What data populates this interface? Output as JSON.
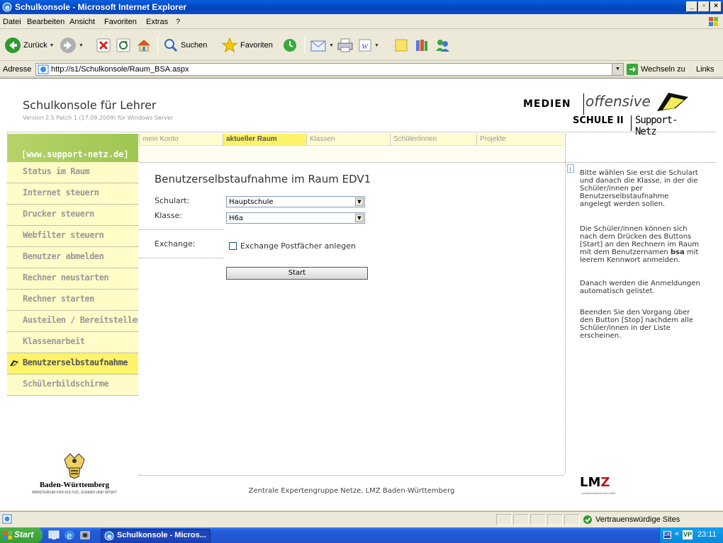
{
  "window": {
    "title": "Schulkonsole - Microsoft Internet Explorer",
    "minimize": "_",
    "maximize": "▫",
    "close": "×"
  },
  "menu": [
    "Datei",
    "Bearbeiten",
    "Ansicht",
    "Favoriten",
    "Extras",
    "?"
  ],
  "toolbar": {
    "back": "Zurück",
    "search": "Suchen",
    "favorites": "Favoriten"
  },
  "address": {
    "label": "Adresse",
    "url": "http://s1/Schulkonsole/Raum_BSA.aspx",
    "go": "Wechseln zu",
    "links": "Links"
  },
  "header": {
    "title": "Schulkonsole für Lehrer",
    "version": "Version 2.5 Patch 1 (17.09.2009) für Windows Server",
    "brand_medien": "MEDIEN",
    "brand_offensive": "offensive",
    "brand_schule": "SCHULE II",
    "brand_support": "Support-Netz"
  },
  "site_badge": "[www.support-netz.de]",
  "tabs": [
    {
      "label": "mein Konto",
      "active": false
    },
    {
      "label": "aktueller Raum",
      "active": true
    },
    {
      "label": "Klassen",
      "active": false
    },
    {
      "label": "Schüler/innen",
      "active": false
    },
    {
      "label": "Projekte",
      "active": false
    }
  ],
  "sidebar": [
    {
      "label": "Status im Raum",
      "active": false
    },
    {
      "label": "Internet steuern",
      "active": false
    },
    {
      "label": "Drucker steuern",
      "active": false
    },
    {
      "label": "Webfilter steuern",
      "active": false
    },
    {
      "label": "Benutzer abmelden",
      "active": false
    },
    {
      "label": "Rechner neustarten",
      "active": false
    },
    {
      "label": "Rechner starten",
      "active": false
    },
    {
      "label": "Austeilen / Bereitstellen",
      "active": false
    },
    {
      "label": "Klassenarbeit",
      "active": false
    },
    {
      "label": "Benutzerselbstaufnahme",
      "active": true
    },
    {
      "label": "Schülerbildschirme",
      "active": false
    }
  ],
  "content": {
    "title": "Benutzerselbstaufnahme im Raum EDV1",
    "schulart_label": "Schulart:",
    "schulart_value": "Hauptschule",
    "klasse_label": "Klasse:",
    "klasse_value": "H6a",
    "exchange_label": "Exchange:",
    "exchange_checkbox": "Exchange Postfächer anlegen",
    "exchange_checked": false,
    "start_button": "Start"
  },
  "help": {
    "p1": "Bitte wählen Sie erst die Schulart und danach die Klasse, in der die Schüler/innen per Benutzerselbstaufnahme angelegt werden sollen.",
    "p2_a": "Die Schüler/innen können sich nach dem Drücken des Buttons [Start] an den Rechnern im Raum mit dem Benutzernamen ",
    "p2_b": "bsa",
    "p2_c": " mit leerem Kennwort anmelden.",
    "p3": "Danach werden die Anmeldungen automatisch gelistet.",
    "p4": "Beenden Sie den Vorgang über den Button [Stop] nachdem alle Schüler/innen in der Liste erscheinen."
  },
  "footer": "Zentrale Expertengruppe Netze, LMZ Baden-Württemberg",
  "bw_logo": {
    "name": "Baden-Württemberg",
    "sub": "MINISTERIUM FÜR KULTUS, JUGEND UND SPORT"
  },
  "lmz_logo": {
    "lm": "LM",
    "z": "Z",
    "sub": "Landesmedienzentrum BW"
  },
  "statusbar": {
    "zone": "Vertrauenswürdige Sites"
  },
  "taskbar": {
    "start": "Start",
    "task": "Schulkonsole - Micros...",
    "lang": "DE",
    "tray_chevron": "«",
    "tray_vp": "VP",
    "clock": "23:11"
  },
  "colors": {
    "nav_bg": "#fffcc8",
    "nav_active": "#fff36a",
    "badge_green": "#9ec650",
    "lmz_red": "#c01818"
  }
}
